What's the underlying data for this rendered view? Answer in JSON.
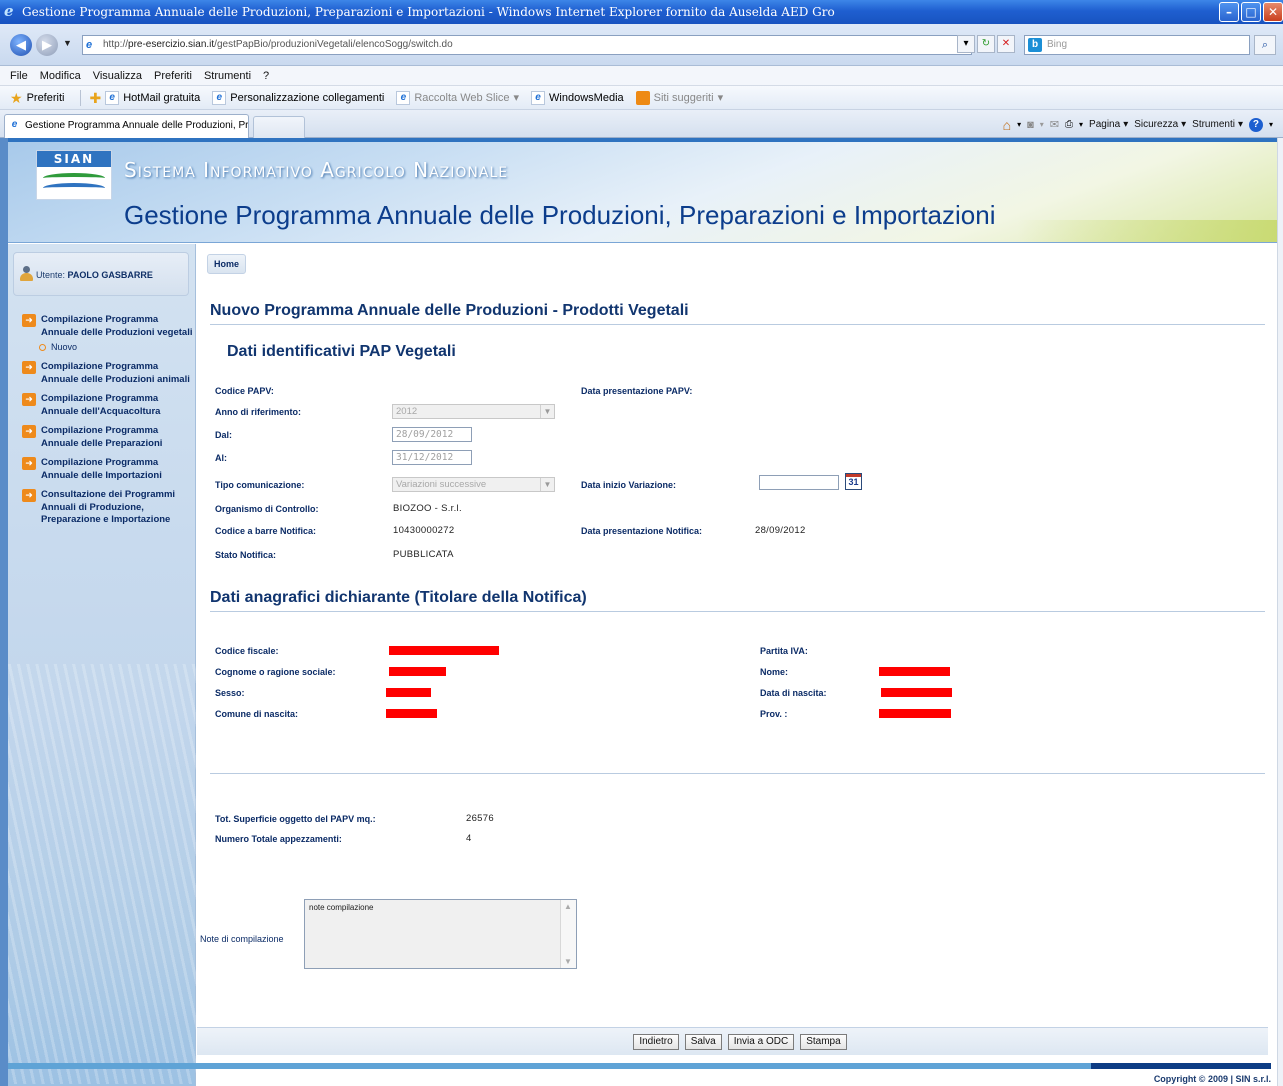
{
  "browser": {
    "window_title": "Gestione Programma Annuale delle Produzioni, Preparazioni e Importazioni - Windows Internet Explorer fornito da Auselda AED Gro",
    "url_prefix": "http://",
    "url_host": "pre-esercizio.sian.it",
    "url_path": "/gestPapBio/produzioniVegetali/elencoSogg/switch.do",
    "search_placeholder": "Bing",
    "menu": [
      "File",
      "Modifica",
      "Visualizza",
      "Preferiti",
      "Strumenti",
      "?"
    ],
    "favorites_label": "Preferiti",
    "favorites": [
      "HotMail gratuita",
      "Personalizzazione collegamenti",
      "Raccolta Web Slice",
      "WindowsMedia",
      "Siti suggeriti"
    ],
    "tab_title": "Gestione Programma Annuale delle Produzioni, Prepar...",
    "commands": [
      "Pagina",
      "Sicurezza",
      "Strumenti"
    ]
  },
  "banner": {
    "logo_text": "SIAN",
    "system_name": "Sistema Informativo Agricolo Nazionale",
    "app_title": "Gestione Programma Annuale delle Produzioni, Preparazioni e Importazioni"
  },
  "sidebar": {
    "user_label": "Utente:",
    "user_name": "PAOLO GASBARRE",
    "items": [
      {
        "label": "Compilazione Programma Annuale delle Produzioni vegetali"
      },
      {
        "label": "Compilazione Programma Annuale delle Produzioni animali"
      },
      {
        "label": "Compilazione Programma Annuale dell'Acquacoltura"
      },
      {
        "label": "Compilazione Programma Annuale delle Preparazioni"
      },
      {
        "label": "Compilazione Programma Annuale delle Importazioni"
      },
      {
        "label": "Consultazione dei Programmi Annuali di Produzione, Preparazione e Importazione"
      }
    ],
    "sub_item": "Nuovo"
  },
  "breadcrumb": "Home",
  "page_title": "Nuovo Programma Annuale delle Produzioni - Prodotti Vegetali",
  "section_ident": {
    "title": "Dati identificativi PAP Vegetali",
    "codice_papv_label": "Codice PAPV:",
    "data_presentazione_papv_label": "Data presentazione PAPV:",
    "anno_label": "Anno di riferimento:",
    "anno_value": "2012",
    "dal_label": "Dal:",
    "dal_value": "28/09/2012",
    "al_label": "Al:",
    "al_value": "31/12/2012",
    "tipo_label": "Tipo comunicazione:",
    "tipo_value": "Variazioni successive",
    "data_inizio_label": "Data inizio Variazione:",
    "data_inizio_value": "",
    "calendar_day": "31",
    "organismo_label": "Organismo di Controllo:",
    "organismo_value": "BIOZOO - S.r.l.",
    "codice_barre_label": "Codice a barre Notifica:",
    "codice_barre_value": "10430000272",
    "data_pres_notifica_label": "Data presentazione Notifica:",
    "data_pres_notifica_value": "28/09/2012",
    "stato_label": "Stato Notifica:",
    "stato_value": "PUBBLICATA"
  },
  "section_anag": {
    "title": "Dati anagrafici dichiarante (Titolare della Notifica)",
    "codice_fiscale_label": "Codice fiscale:",
    "partita_iva_label": "Partita IVA:",
    "cognome_label": "Cognome o ragione sociale:",
    "nome_label": "Nome:",
    "sesso_label": "Sesso:",
    "data_nascita_label": "Data di nascita:",
    "comune_label": "Comune di nascita:",
    "prov_label": "Prov. :",
    "redaction_color": "#ff0000"
  },
  "totals": {
    "superficie_label": "Tot. Superficie oggetto del PAPV mq.:",
    "superficie_value": "26576",
    "appezzamenti_label": "Numero Totale appezzamenti:",
    "appezzamenti_value": "4"
  },
  "notes": {
    "label": "Note di compilazione",
    "value": "note compilazione"
  },
  "buttons": {
    "indietro": "Indietro",
    "salva": "Salva",
    "invia": "Invia a ODC",
    "stampa": "Stampa"
  },
  "copyright": "Copyright © 2009 | SIN s.r.l.",
  "colors": {
    "accent_blue": "#11356f",
    "nav_arrow": "#ee8a1b",
    "footer_light": "#5fa3d6",
    "footer_dark": "#0d3c84"
  }
}
